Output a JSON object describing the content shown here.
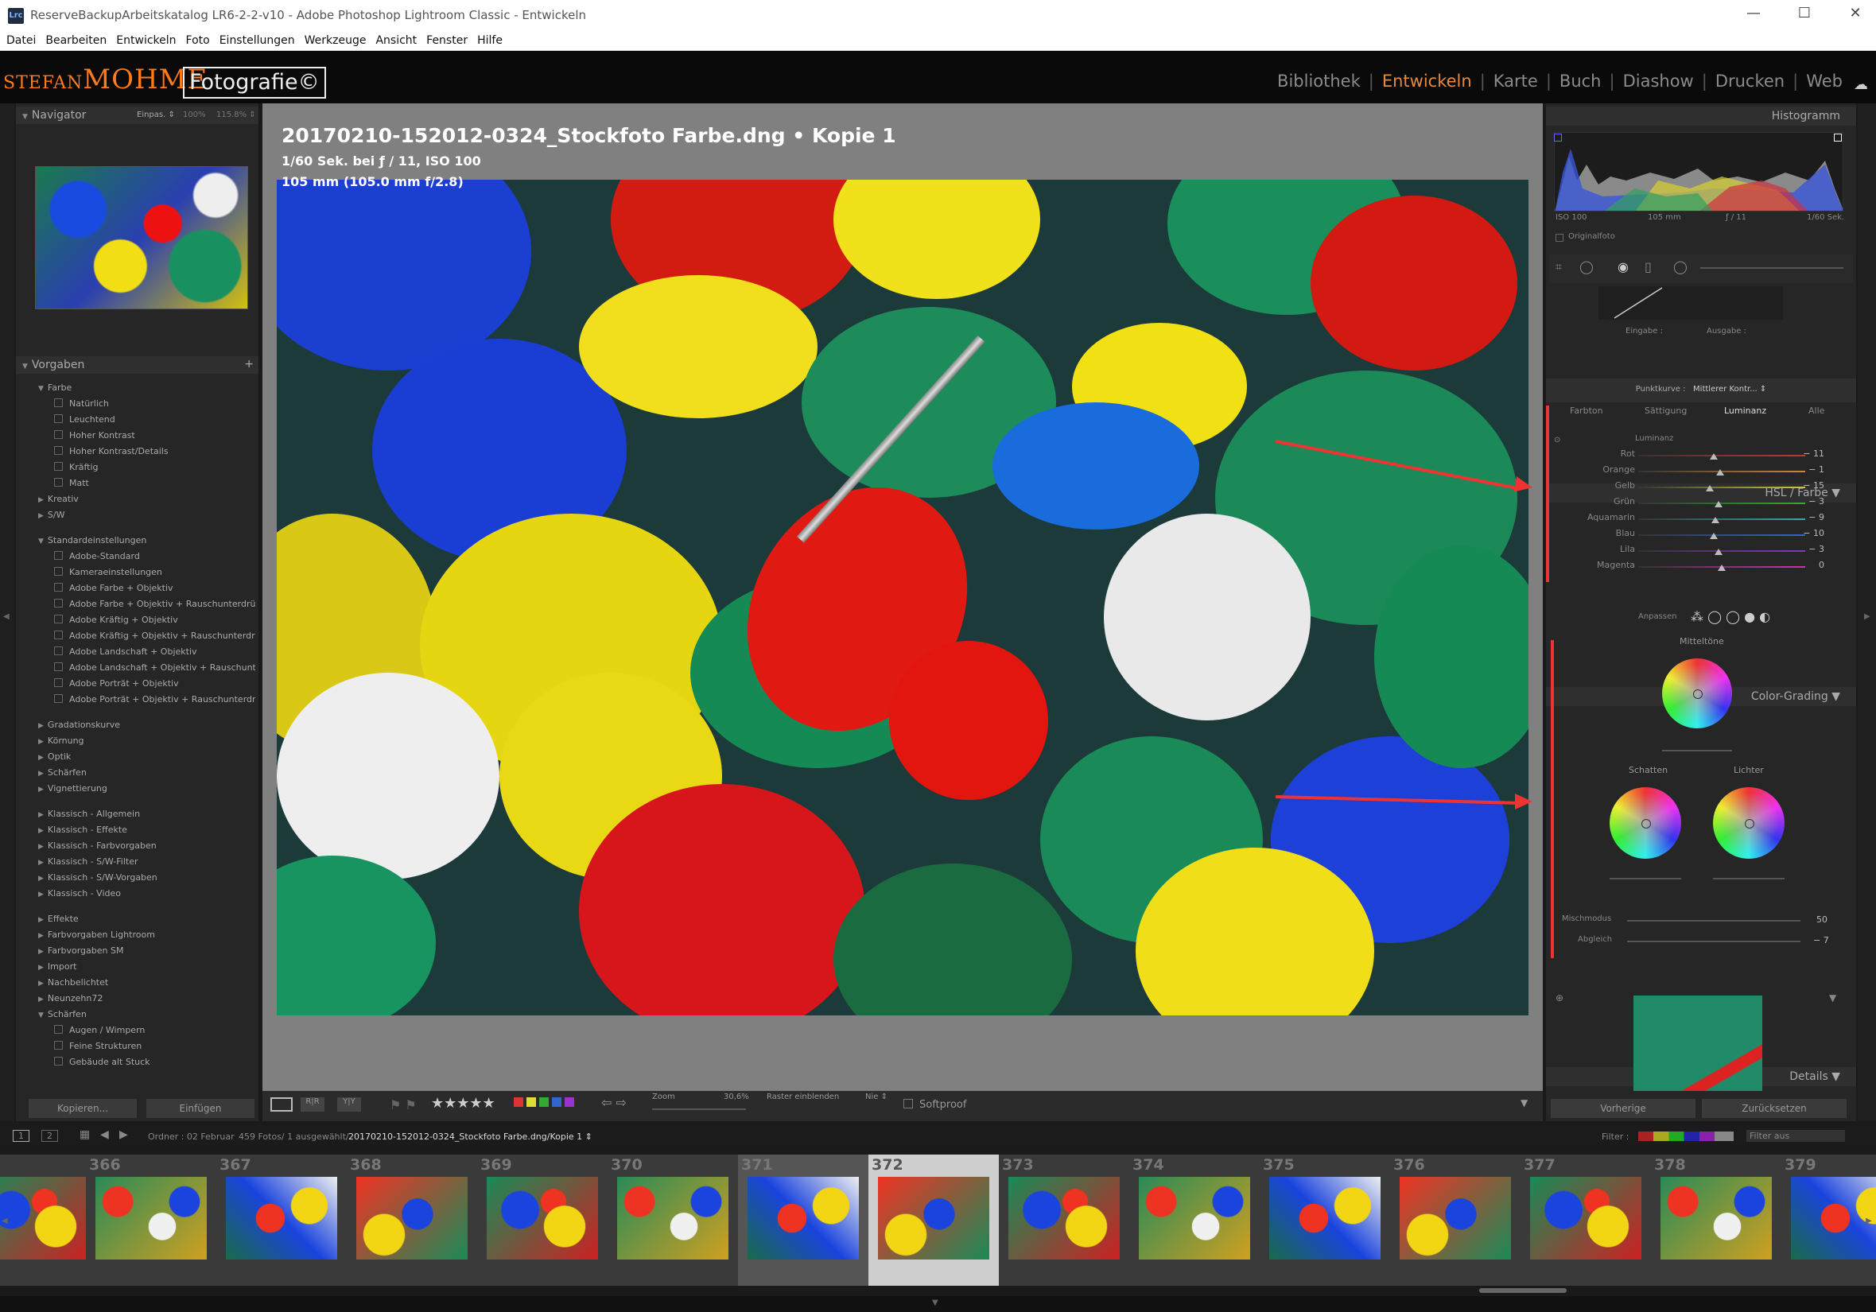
{
  "window": {
    "title": "ReserveBackupArbeitskatalog LR6-2-2-v10 - Adobe Photoshop Lightroom Classic - Entwickeln",
    "app_icon": "Lrc"
  },
  "menu": [
    "Datei",
    "Bearbeiten",
    "Entwickeln",
    "Foto",
    "Einstellungen",
    "Werkzeuge",
    "Ansicht",
    "Fenster",
    "Hilfe"
  ],
  "identity": {
    "name_small": "STEFAN",
    "name_big": "MOHME",
    "badge": "Fotografie©"
  },
  "modules": [
    "Bibliothek",
    "Entwickeln",
    "Karte",
    "Buch",
    "Diashow",
    "Drucken",
    "Web"
  ],
  "active_module": "Entwickeln",
  "navigator": {
    "title": "Navigator",
    "opt1": "Einpas. ⇕",
    "opt2": "100%",
    "opt3": "115.8% ⇕"
  },
  "presets": {
    "title": "Vorgaben",
    "items": [
      {
        "t": "Farbe",
        "lvl": 1,
        "open": true
      },
      {
        "t": "Natürlich",
        "lvl": 2
      },
      {
        "t": "Leuchtend",
        "lvl": 2
      },
      {
        "t": "Hoher Kontrast",
        "lvl": 2
      },
      {
        "t": "Hoher Kontrast/Details",
        "lvl": 2
      },
      {
        "t": "Kräftig",
        "lvl": 2
      },
      {
        "t": "Matt",
        "lvl": 2
      },
      {
        "t": "Kreativ",
        "lvl": 1
      },
      {
        "t": "S/W",
        "lvl": 1
      },
      {
        "t": "",
        "lvl": 0
      },
      {
        "t": "Standardeinstellungen",
        "lvl": 1,
        "open": true
      },
      {
        "t": "Adobe-Standard",
        "lvl": 2
      },
      {
        "t": "Kameraeinstellungen",
        "lvl": 2
      },
      {
        "t": "Adobe Farbe + Objektiv",
        "lvl": 2
      },
      {
        "t": "Adobe Farbe + Objektiv + Rauschunterdrü...",
        "lvl": 2
      },
      {
        "t": "Adobe Kräftig + Objektiv",
        "lvl": 2
      },
      {
        "t": "Adobe Kräftig + Objektiv + Rauschunterdrü...",
        "lvl": 2
      },
      {
        "t": "Adobe Landschaft + Objektiv",
        "lvl": 2
      },
      {
        "t": "Adobe Landschaft + Objektiv + Rauschunte...",
        "lvl": 2
      },
      {
        "t": "Adobe Porträt + Objektiv",
        "lvl": 2
      },
      {
        "t": "Adobe Porträt + Objektiv + Rauschunterdrü...",
        "lvl": 2
      },
      {
        "t": "",
        "lvl": 0
      },
      {
        "t": "Gradationskurve",
        "lvl": 1
      },
      {
        "t": "Körnung",
        "lvl": 1
      },
      {
        "t": "Optik",
        "lvl": 1
      },
      {
        "t": "Schärfen",
        "lvl": 1
      },
      {
        "t": "Vignettierung",
        "lvl": 1
      },
      {
        "t": "",
        "lvl": 0
      },
      {
        "t": "Klassisch - Allgemein",
        "lvl": 1
      },
      {
        "t": "Klassisch - Effekte",
        "lvl": 1
      },
      {
        "t": "Klassisch - Farbvorgaben",
        "lvl": 1
      },
      {
        "t": "Klassisch - S/W-Filter",
        "lvl": 1
      },
      {
        "t": "Klassisch - S/W-Vorgaben",
        "lvl": 1
      },
      {
        "t": "Klassisch - Video",
        "lvl": 1
      },
      {
        "t": "",
        "lvl": 0
      },
      {
        "t": "Effekte",
        "lvl": 1
      },
      {
        "t": "Farbvorgaben Lightroom",
        "lvl": 1
      },
      {
        "t": "Farbvorgaben SM",
        "lvl": 1
      },
      {
        "t": "Import",
        "lvl": 1
      },
      {
        "t": "Nachbelichtet",
        "lvl": 1
      },
      {
        "t": "Neunzehn72",
        "lvl": 1
      },
      {
        "t": "Schärfen",
        "lvl": 1,
        "open": true
      },
      {
        "t": "Augen / Wimpern",
        "lvl": 2
      },
      {
        "t": "Feine Strukturen",
        "lvl": 2
      },
      {
        "t": "Gebäude alt Stuck",
        "lvl": 2
      }
    ]
  },
  "left_buttons": {
    "copy": "Kopieren...",
    "paste": "Einfügen"
  },
  "photo_info": {
    "filename": "20170210-152012-0324_Stockfoto Farbe.dng  •  Kopie 1",
    "exposure": "1/60 Sek. bei ƒ / 11, ISO 100",
    "lens": "105 mm (105.0 mm f/2.8)"
  },
  "toolbar": {
    "stars": "★★★★★",
    "zoom_label": "Zoom",
    "zoom_val": "30,6%",
    "raster_label": "Raster einblenden",
    "raster_val": "Nie ⇕",
    "softproof": "Softproof",
    "label_colors": [
      "#d33",
      "#dd3",
      "#3a3",
      "#36c",
      "#93c"
    ]
  },
  "histogram": {
    "title": "Histogramm",
    "iso": "ISO 100",
    "focal": "105 mm",
    "aperture": "ƒ / 11",
    "shutter": "1/60 Sek.",
    "original": "Originalfoto"
  },
  "curve": {
    "input": "Eingabe :",
    "output": "Ausgabe :",
    "point_label": "Punktkurve :",
    "point_val": "Mittlerer Kontr... ⇕"
  },
  "hsl": {
    "title": "HSL / Farbe",
    "tabs": [
      "Farbton",
      "Sättigung",
      "Luminanz",
      "Alle"
    ],
    "active_tab": "Luminanz",
    "group": "Luminanz",
    "rows": [
      {
        "n": "Rot",
        "v": "− 11",
        "pos": 0.45,
        "c": "#c33"
      },
      {
        "n": "Orange",
        "v": "− 1",
        "pos": 0.49,
        "c": "#c83"
      },
      {
        "n": "Gelb",
        "v": "− 15",
        "pos": 0.43,
        "c": "#cc3"
      },
      {
        "n": "Grün",
        "v": "− 3",
        "pos": 0.48,
        "c": "#3a3"
      },
      {
        "n": "Aquamarin",
        "v": "− 9",
        "pos": 0.46,
        "c": "#3aa"
      },
      {
        "n": "Blau",
        "v": "− 10",
        "pos": 0.45,
        "c": "#36c"
      },
      {
        "n": "Lila",
        "v": "− 3",
        "pos": 0.48,
        "c": "#83c"
      },
      {
        "n": "Magenta",
        "v": "0",
        "pos": 0.5,
        "c": "#c3a"
      }
    ]
  },
  "color_grading": {
    "title": "Color-Grading",
    "adjust": "Anpassen",
    "mid": "Mitteltöne",
    "shadows": "Schatten",
    "highlights": "Lichter",
    "blend_label": "Mischmodus",
    "blend_val": "50",
    "balance_label": "Abgleich",
    "balance_val": "− 7"
  },
  "details": {
    "title": "Details"
  },
  "right_buttons": {
    "prev": "Vorherige",
    "reset": "Zurücksetzen"
  },
  "filmbar": {
    "page1": "1",
    "page2": "2",
    "folder": "Ordner : 02 Februar",
    "count": "459 Fotos/ 1 ausgewählt/",
    "file": "20170210-152012-0324_Stockfoto Farbe.dng/Kopie 1 ⇕",
    "filter": "Filter :",
    "filter_val": "Filter aus"
  },
  "filmstrip": [
    {
      "n": "",
      "sel": false
    },
    {
      "n": "366",
      "sel": false
    },
    {
      "n": "367",
      "sel": false
    },
    {
      "n": "368",
      "sel": false
    },
    {
      "n": "369",
      "sel": false
    },
    {
      "n": "370",
      "sel": false
    },
    {
      "n": "371",
      "sel": false,
      "prev": true
    },
    {
      "n": "372",
      "sel": true
    },
    {
      "n": "373",
      "sel": false
    },
    {
      "n": "374",
      "sel": false
    },
    {
      "n": "375",
      "sel": false
    },
    {
      "n": "376",
      "sel": false
    },
    {
      "n": "377",
      "sel": false
    },
    {
      "n": "378",
      "sel": false
    },
    {
      "n": "379",
      "sel": false
    }
  ]
}
